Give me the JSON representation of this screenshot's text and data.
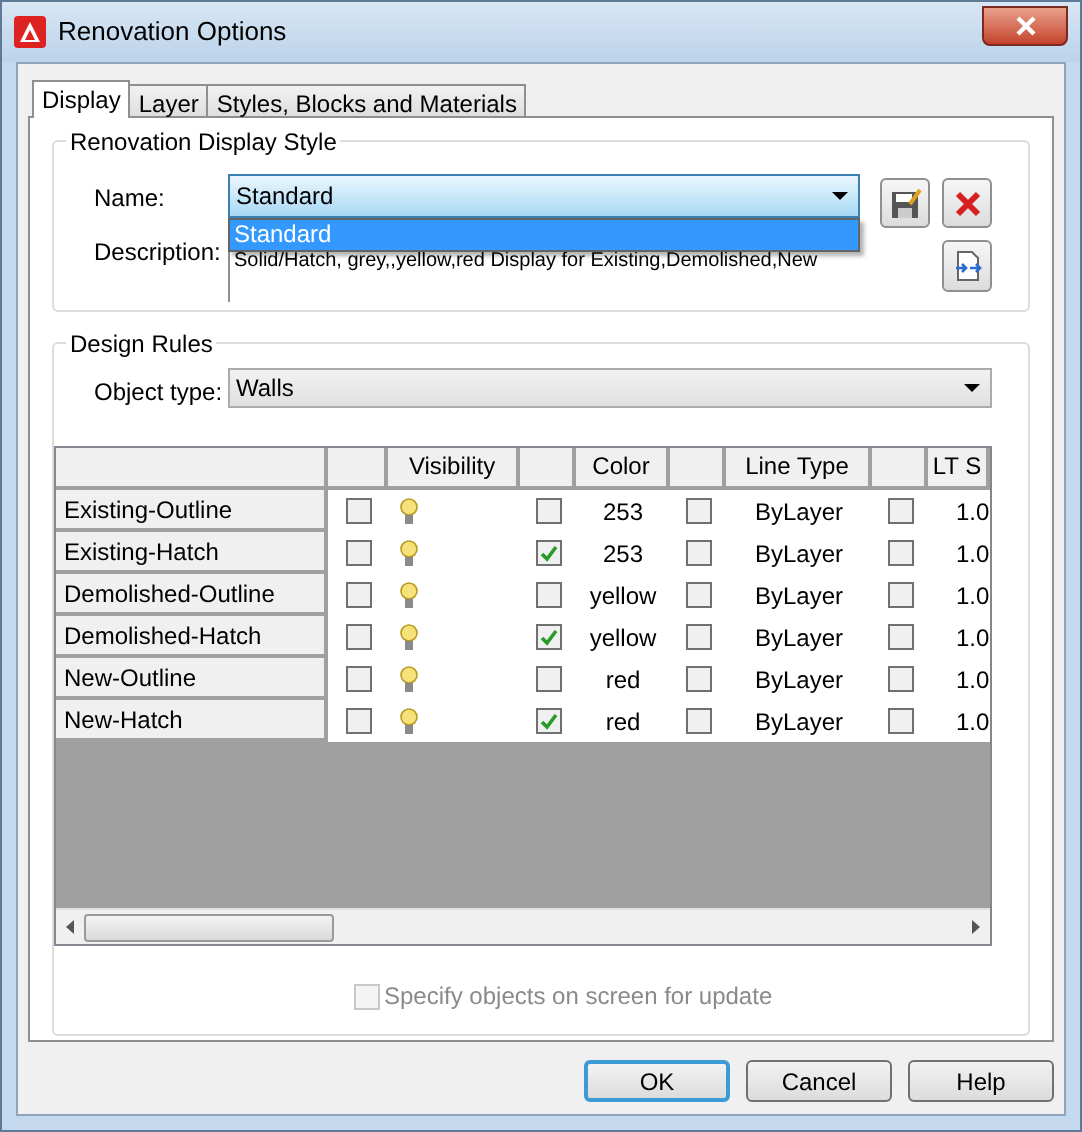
{
  "window": {
    "title": "Renovation Options"
  },
  "tabs": [
    {
      "label": "Display",
      "selected": true
    },
    {
      "label": "Layer",
      "selected": false
    },
    {
      "label": "Styles, Blocks and Materials",
      "selected": false
    }
  ],
  "display_style": {
    "title": "Renovation Display Style",
    "name_label": "Name:",
    "name_value": "Standard",
    "dropdown_items": [
      {
        "label": "Standard",
        "selected": true
      }
    ],
    "description_label": "Description:",
    "description": "Solid/Hatch, grey,,yellow,red Display for Existing,Demolished,New"
  },
  "design_rules": {
    "title": "Design Rules",
    "object_type_label": "Object type:",
    "object_type": "Walls",
    "columns": [
      {
        "kind": "name"
      },
      {
        "kind": "check"
      },
      {
        "kind": "text",
        "label": "Visibility"
      },
      {
        "kind": "check"
      },
      {
        "kind": "text",
        "label": "Color"
      },
      {
        "kind": "check"
      },
      {
        "kind": "text",
        "label": "Line Type"
      },
      {
        "kind": "check"
      },
      {
        "kind": "text",
        "label": "LT S"
      }
    ],
    "rows": [
      {
        "name": "Existing-Outline",
        "check_1": false,
        "visible": true,
        "check_2": false,
        "color_name": "253",
        "check_3": false,
        "line_type": "ByLayer",
        "check_4": false,
        "lt_scale": "1.0"
      },
      {
        "name": "Existing-Hatch",
        "check_1": false,
        "visible": true,
        "check_2": true,
        "color_name": "253",
        "check_3": false,
        "line_type": "ByLayer",
        "check_4": false,
        "lt_scale": "1.0"
      },
      {
        "name": "Demolished-Outline",
        "check_1": false,
        "visible": true,
        "check_2": false,
        "color_name": "yellow",
        "check_3": false,
        "line_type": "ByLayer",
        "check_4": false,
        "lt_scale": "1.0"
      },
      {
        "name": "Demolished-Hatch",
        "check_1": false,
        "visible": true,
        "check_2": true,
        "color_name": "yellow",
        "check_3": false,
        "line_type": "ByLayer",
        "check_4": false,
        "lt_scale": "1.0"
      },
      {
        "name": "New-Outline",
        "check_1": false,
        "visible": true,
        "check_2": false,
        "color_name": "red",
        "check_3": false,
        "line_type": "ByLayer",
        "check_4": false,
        "lt_scale": "1.0"
      },
      {
        "name": "New-Hatch",
        "check_1": false,
        "visible": true,
        "check_2": true,
        "color_name": "red",
        "check_3": false,
        "line_type": "ByLayer",
        "check_4": false,
        "lt_scale": "1.0"
      }
    ],
    "specify_checkbox": {
      "label": "Specify objects on screen for update",
      "checked": false,
      "disabled": true
    }
  },
  "buttons": [
    {
      "label": "OK",
      "default": true
    },
    {
      "label": "Cancel",
      "default": false
    },
    {
      "label": "Help",
      "default": false
    }
  ]
}
